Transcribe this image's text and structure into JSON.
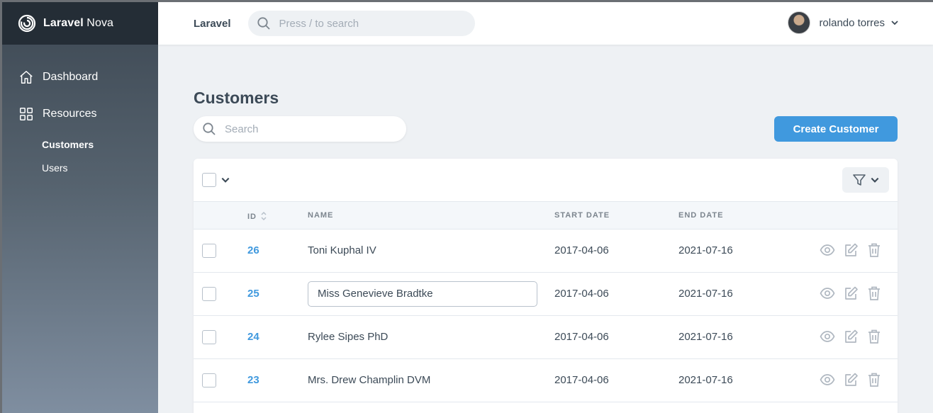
{
  "brand": {
    "name_bold": "Laravel",
    "name_light": "Nova"
  },
  "sidebar": {
    "items": [
      {
        "label": "Dashboard",
        "icon": "home-icon"
      },
      {
        "label": "Resources",
        "icon": "grid-icon"
      }
    ],
    "resources": [
      {
        "label": "Customers",
        "active": true
      },
      {
        "label": "Users",
        "active": false
      }
    ]
  },
  "header": {
    "app": "Laravel",
    "search_placeholder": "Press / to search",
    "user_name": "rolando torres"
  },
  "page": {
    "title": "Customers",
    "search_placeholder": "Search",
    "create_label": "Create Customer"
  },
  "table": {
    "columns": {
      "id": "ID",
      "name": "NAME",
      "start": "START DATE",
      "end": "END DATE"
    },
    "rows": [
      {
        "id": "26",
        "name": "Toni Kuphal IV",
        "start": "2017-04-06",
        "end": "2021-07-16"
      },
      {
        "id": "25",
        "name": "Miss Genevieve Bradtke",
        "start": "2017-04-06",
        "end": "2021-07-16"
      },
      {
        "id": "24",
        "name": "Rylee Sipes PhD",
        "start": "2017-04-06",
        "end": "2021-07-16"
      },
      {
        "id": "23",
        "name": "Mrs. Drew Champlin DVM",
        "start": "2017-04-06",
        "end": "2021-07-16"
      }
    ]
  },
  "colors": {
    "accent": "#4099de",
    "sidebar_top": "#242d36",
    "text": "#3c4a57",
    "muted": "#7c858e",
    "background": "#eef1f4"
  }
}
